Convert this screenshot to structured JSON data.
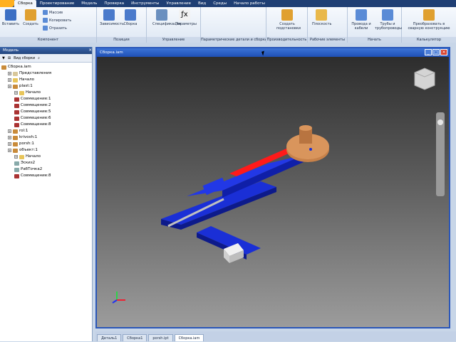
{
  "menu": {
    "tabs": [
      "Сборка",
      "Проектирование",
      "Модель",
      "Проверка",
      "Инструменты",
      "Управление",
      "Вид",
      "Среды",
      "Начало работы"
    ]
  },
  "ribbon": {
    "groups": [
      {
        "label": "Компонент"
      },
      {
        "label": "Позиция"
      },
      {
        "label": "Управление"
      },
      {
        "label": "Параметрические детали и сборки"
      },
      {
        "label": "Производительность"
      },
      {
        "label": "Рабочие элементы"
      },
      {
        "label": "Начать"
      },
      {
        "label": "Калькулятор"
      }
    ],
    "buttons": {
      "insert": "Вставить",
      "create": "Создать",
      "pattern": "Массив",
      "copy": "Копировать",
      "mirror": "Отразить",
      "constraint": "Зависимость",
      "assemble": "Сборка",
      "bom": "Спецификация",
      "params": "Параметры",
      "create_sub": "Создать подстановки",
      "plane": "Плоскость",
      "wires": "Провода и кабели",
      "pipes": "Трубы и трубопроводы",
      "convert": "Преобразовать в сварную конструкцию"
    }
  },
  "browser": {
    "title": "Модель",
    "view": "Вид сборки",
    "tree": [
      {
        "label": "Сборка.iam",
        "level": 0,
        "exp": false,
        "color": "#c98b3a"
      },
      {
        "label": "Представления",
        "level": 1,
        "exp": true,
        "color": "#d8c79a"
      },
      {
        "label": "Начало",
        "level": 1,
        "exp": true,
        "color": "#e8c55a"
      },
      {
        "label": "plast:1",
        "level": 1,
        "exp": true,
        "color": "#c98b3a"
      },
      {
        "label": "Начало",
        "level": 2,
        "exp": true,
        "color": "#e8c55a"
      },
      {
        "label": "Совмещение:1",
        "level": 2,
        "exp": false,
        "color": "#a33"
      },
      {
        "label": "Совмещение:2",
        "level": 2,
        "exp": false,
        "color": "#a33"
      },
      {
        "label": "Совмещение:5",
        "level": 2,
        "exp": false,
        "color": "#a33"
      },
      {
        "label": "Совмещение:6",
        "level": 2,
        "exp": false,
        "color": "#a33"
      },
      {
        "label": "Совмещение:8",
        "level": 2,
        "exp": false,
        "color": "#a33"
      },
      {
        "label": "rol:1",
        "level": 1,
        "exp": true,
        "color": "#c98b3a"
      },
      {
        "label": "krivosh:1",
        "level": 1,
        "exp": true,
        "color": "#c98b3a"
      },
      {
        "label": "porsh:1",
        "level": 1,
        "exp": true,
        "color": "#c98b3a"
      },
      {
        "label": "объект:1",
        "level": 1,
        "exp": true,
        "color": "#c98b3a"
      },
      {
        "label": "Начало",
        "level": 2,
        "exp": true,
        "color": "#e8c55a"
      },
      {
        "label": "Эскиз2",
        "level": 2,
        "exp": false,
        "color": "#8aa"
      },
      {
        "label": "РабТочка2",
        "level": 2,
        "exp": false,
        "color": "#8aa"
      },
      {
        "label": "Совмещение:8",
        "level": 2,
        "exp": false,
        "color": "#a33"
      }
    ]
  },
  "viewport": {
    "title": "Сборка.iam"
  },
  "doctabs": [
    "Деталь1",
    "Сборка1",
    "porsh.ipt",
    "Сборка.iam"
  ],
  "colors": {
    "part_blue": "#1a2fd6",
    "slot_red": "#ff1a1a",
    "disk": "#c8824a",
    "block": "#e8e8e8",
    "rod": "#bfbfbf"
  }
}
